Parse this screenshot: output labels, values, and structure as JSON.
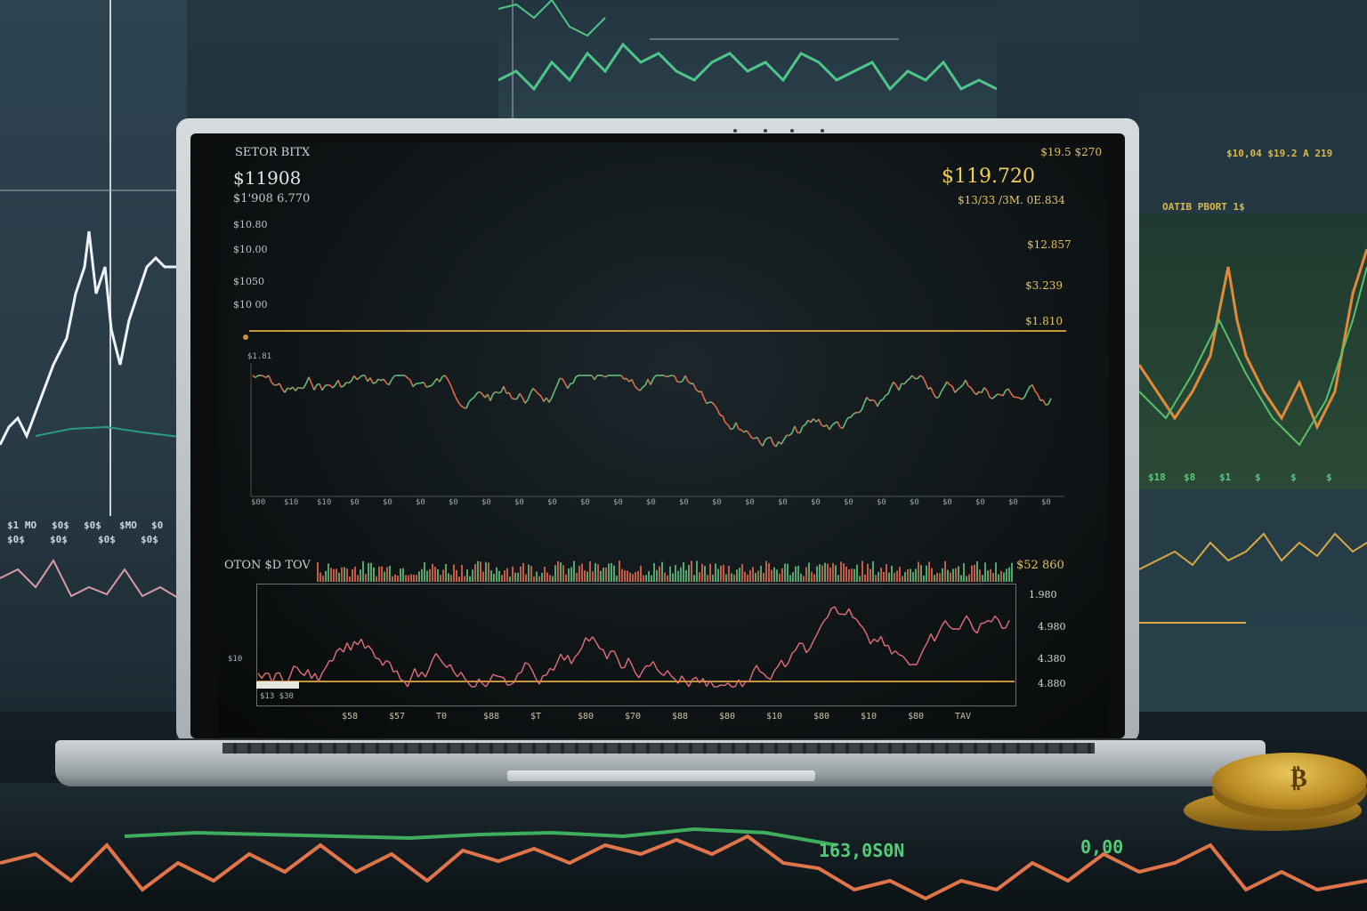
{
  "screen": {
    "title": "SETOR BITX",
    "price_left": "$11908",
    "subprice_left": "$1'908 6.770",
    "left_levels": [
      "$10.80",
      "$10.00",
      "$1050",
      "$10 00"
    ],
    "top_right_label": "$19.5 $270",
    "price_right": "$119.720",
    "subprice_right": "$13/33 /3M. 0E.834",
    "right_levels": [
      "$12.857",
      "$3.239",
      "$1.810"
    ],
    "chart_small_label": "$1.81",
    "xaxis_labels": [
      "$00",
      "$10",
      "$10",
      "$0",
      "$0",
      "$0",
      "$0",
      "$0",
      "$0",
      "$0",
      "$0",
      "$0",
      "$0",
      "$0",
      "$0",
      "$0",
      "$0",
      "$0",
      "$0",
      "$0",
      "$0",
      "$0",
      "$0",
      "$0",
      "$0"
    ],
    "second_panel_label": "OTON $D TOV",
    "second_panel_price": "$52 860",
    "second_panel_ticks": [
      "1.980",
      "4.980",
      "4.380",
      "4.880"
    ],
    "second_panel_left_label": "$10",
    "second_panel_corner": "$13 $30",
    "bottom_axis_labels": [
      "$58",
      "$57",
      "T0",
      "$88",
      "$T",
      "$80",
      "$70",
      "$88",
      "$80",
      "$10",
      "$80",
      "$10",
      "$80",
      "TAV"
    ]
  },
  "background": {
    "left_monitor_labels": [
      "$1 MO",
      "$0$",
      "$0$",
      "$MO",
      "$0",
      "$0$",
      "$0$",
      "$0$",
      "$0$"
    ],
    "right_monitor_top_label": "$10,04 $19.2 A 219",
    "right_monitor_panel_label": "OATIB PBORT 1$",
    "right_monitor_axis": [
      "$18",
      "$8",
      "$1",
      "$",
      "$",
      "$"
    ],
    "desk_reading_left": "163,0S0N",
    "desk_reading_right": "0,00"
  },
  "colors": {
    "up": "#5fbf7e",
    "down": "#e06a4c",
    "gold": "#f0cf55",
    "screen_bg": "#0f1416"
  }
}
